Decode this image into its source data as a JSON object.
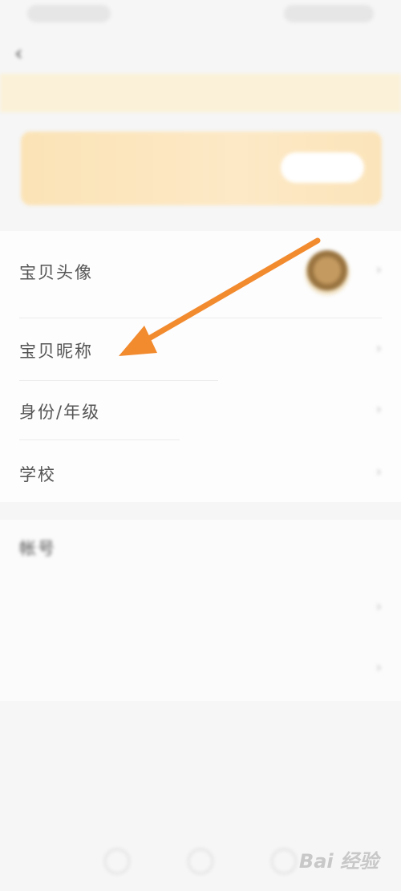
{
  "nav": {
    "title": "",
    "back_icon": "chevron-left-icon"
  },
  "notice": {
    "text": ""
  },
  "banner": {
    "title": "",
    "subtitle": "",
    "button_label": ""
  },
  "profile": {
    "rows": [
      {
        "label": "宝贝头像",
        "value": ""
      },
      {
        "label": "宝贝昵称",
        "value": ""
      },
      {
        "label": "身份/年级",
        "value": ""
      },
      {
        "label": "学校",
        "value": ""
      }
    ]
  },
  "account": {
    "rows": [
      {
        "label": "帐号",
        "value": ""
      },
      {
        "label": "",
        "value": ""
      },
      {
        "label": "",
        "value": ""
      }
    ]
  },
  "footer": {
    "text": ""
  },
  "watermark": {
    "text": "Bai 经验"
  },
  "colors": {
    "accent_orange": "#f28a2e",
    "notice_bg": "#fbf1d8",
    "banner_bg": "#fde9c6"
  }
}
